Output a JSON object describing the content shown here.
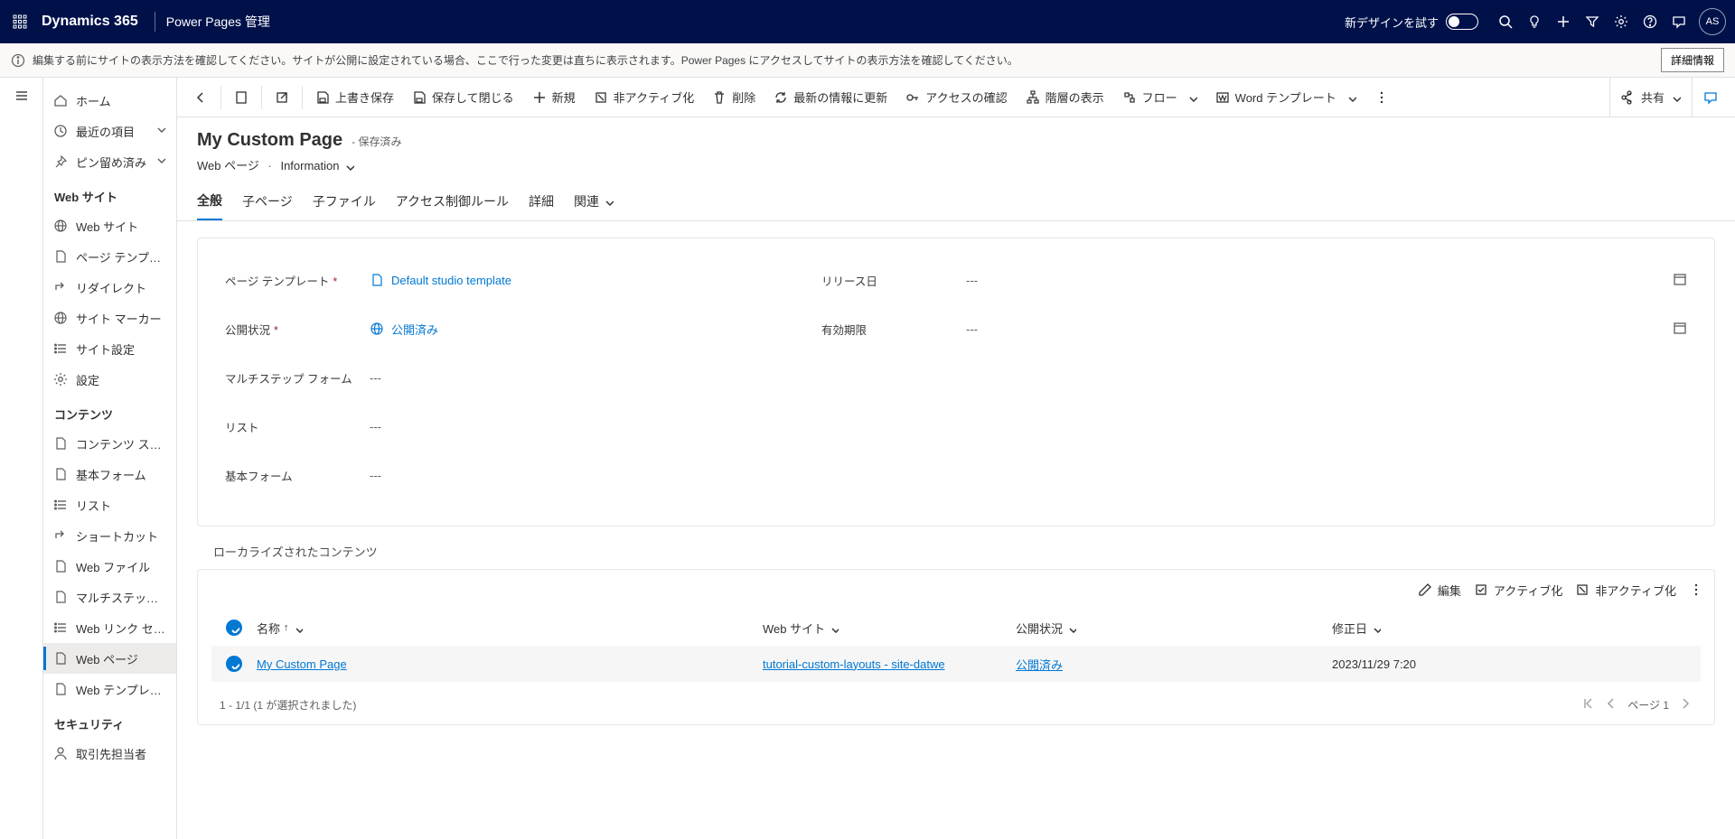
{
  "header": {
    "brand": "Dynamics 365",
    "subtitle": "Power Pages 管理",
    "tryNew": "新デザインを試す",
    "avatar": "AS"
  },
  "infobar": {
    "text": "編集する前にサイトの表示方法を確認してください。サイトが公開に設定されている場合、ここで行った変更は直ちに表示されます。Power Pages にアクセスしてサイトの表示方法を確認してください。",
    "button": "詳細情報"
  },
  "sidebar": {
    "top": {
      "home": "ホーム",
      "recent": "最近の項目",
      "pinned": "ピン留め済み"
    },
    "sections": {
      "websiteTitle": "Web サイト",
      "website": {
        "websites": "Web サイト",
        "pageTemplates": "ページ テンプレ…",
        "redirects": "リダイレクト",
        "siteMarkers": "サイト マーカー",
        "siteSettings": "サイト設定",
        "settings": "設定"
      },
      "contentTitle": "コンテンツ",
      "content": {
        "snippets": "コンテンツ スニ…",
        "basicForms": "基本フォーム",
        "lists": "リスト",
        "shortcuts": "ショートカット",
        "webFiles": "Web ファイル",
        "multistep": "マルチステップ …",
        "webLinkSets": "Web リンク セット",
        "webPages": "Web ページ",
        "webTemplates": "Web テンプレート"
      },
      "securityTitle": "セキュリティ",
      "security": {
        "contacts": "取引先担当者"
      }
    }
  },
  "commands": {
    "save": "上書き保存",
    "saveClose": "保存して閉じる",
    "new": "新規",
    "deactivate": "非アクティブ化",
    "delete": "削除",
    "refresh": "最新の情報に更新",
    "checkAccess": "アクセスの確認",
    "hierarchy": "階層の表示",
    "flow": "フロー",
    "wordTemplates": "Word テンプレート",
    "share": "共有"
  },
  "page": {
    "title": "My Custom Page",
    "saveState": "- 保存済み",
    "breadcrumb1": "Web ページ",
    "breadcrumb2": "Information"
  },
  "tabs": {
    "general": "全般",
    "childPages": "子ページ",
    "childFiles": "子ファイル",
    "accessRules": "アクセス制御ルール",
    "details": "詳細",
    "related": "関連"
  },
  "form": {
    "labels": {
      "pageTemplate": "ページ テンプレート",
      "publishState": "公開状況",
      "multistepForm": "マルチステップ フォーム",
      "list": "リスト",
      "basicForm": "基本フォーム",
      "releaseDate": "リリース日",
      "expiration": "有効期限"
    },
    "values": {
      "pageTemplate": "Default studio template",
      "publishState": "公開済み",
      "multistepForm": "---",
      "list": "---",
      "basicForm": "---",
      "releaseDate": "---",
      "expiration": "---"
    }
  },
  "localized": {
    "title": "ローカライズされたコンテンツ",
    "toolbar": {
      "edit": "編集",
      "activate": "アクティブ化",
      "deactivate": "非アクティブ化"
    },
    "columns": {
      "name": "名称",
      "website": "Web サイト",
      "publishState": "公開状況",
      "modified": "修正日"
    },
    "rows": [
      {
        "name": "My Custom Page",
        "website": "tutorial-custom-layouts - site-datwe",
        "publishState": "公開済み",
        "modified": "2023/11/29 7:20"
      }
    ],
    "footer": "1 - 1/1 (1 が選択されました)",
    "page": "ページ 1"
  }
}
